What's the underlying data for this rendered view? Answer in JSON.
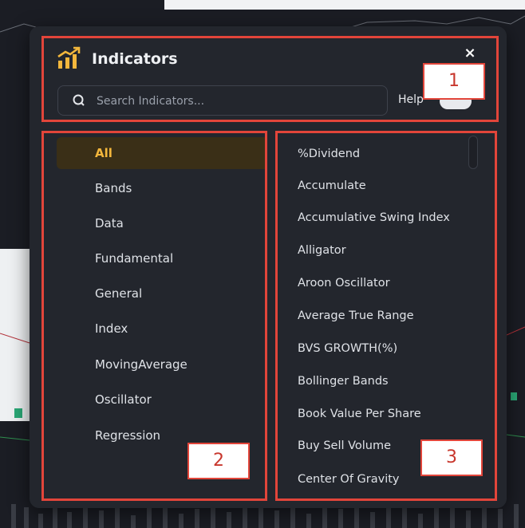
{
  "modal": {
    "title": "Indicators",
    "close_glyph": "×",
    "search_placeholder": "Search Indicators...",
    "help_label": "Help",
    "accent_color": "#f3b73c"
  },
  "categories": [
    {
      "label": "All",
      "active": true
    },
    {
      "label": "Bands"
    },
    {
      "label": "Data"
    },
    {
      "label": "Fundamental"
    },
    {
      "label": "General"
    },
    {
      "label": "Index"
    },
    {
      "label": "MovingAverage"
    },
    {
      "label": "Oscillator"
    },
    {
      "label": "Regression"
    }
  ],
  "indicators": [
    "%Dividend",
    "Accumulate",
    "Accumulative Swing Index",
    "Alligator",
    "Aroon Oscillator",
    "Average True Range",
    "BVS GROWTH(%)",
    "Bollinger Bands",
    "Book Value Per Share",
    "Buy Sell Volume",
    "Center Of Gravity"
  ],
  "annotations": [
    "1",
    "2",
    "3"
  ]
}
